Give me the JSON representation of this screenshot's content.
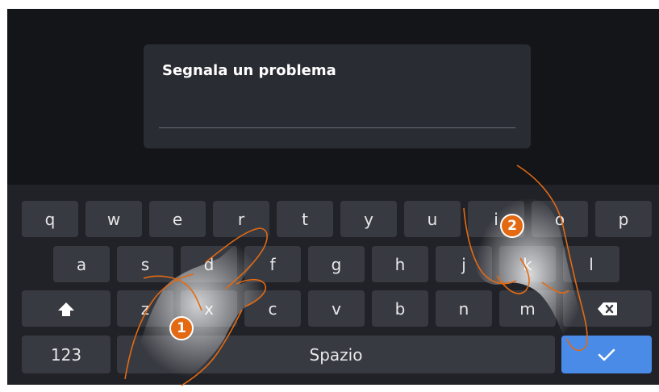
{
  "dialog": {
    "title": "Segnala un problema"
  },
  "keyboard": {
    "row1": [
      "q",
      "w",
      "e",
      "r",
      "t",
      "y",
      "u",
      "i",
      "o",
      "p"
    ],
    "row2": [
      "a",
      "s",
      "d",
      "f",
      "g",
      "h",
      "j",
      "k",
      "l"
    ],
    "row3": [
      "z",
      "x",
      "c",
      "v",
      "b",
      "n",
      "m"
    ],
    "shift_icon": "shift-up-arrow-icon",
    "backspace_icon": "backspace-icon",
    "numbers_label": "123",
    "space_label": "Spazio",
    "confirm_icon": "checkmark-icon"
  },
  "annotations": {
    "step1": "1",
    "step2": "2"
  },
  "colors": {
    "accent": "#4a8be8",
    "badge": "#e36a13",
    "key": "#383a41",
    "screen": "#141518"
  }
}
